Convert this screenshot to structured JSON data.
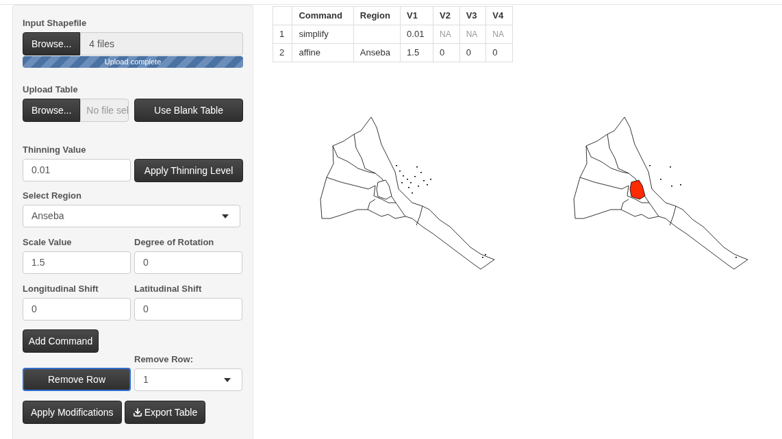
{
  "sidebar": {
    "shapefile": {
      "label": "Input Shapefile",
      "browse": "Browse...",
      "value": "4 files",
      "progress": {
        "level": 1,
        "text": "Upload complete"
      }
    },
    "upload_table": {
      "label": "Upload Table",
      "browse": "Browse...",
      "placeholder": "No file sel",
      "button": "Use Blank Table"
    },
    "thinning": {
      "label": "Thinning Value",
      "value": "0.01",
      "button": "Apply Thinning Level"
    },
    "region": {
      "label": "Select Region",
      "value": "Anseba"
    },
    "pairs": [
      [
        {
          "label": "Scale Value",
          "value": "1.5"
        },
        {
          "label": "Degree of Rotation",
          "value": "0"
        }
      ],
      [
        {
          "label": "Longitudinal Shift",
          "value": "0"
        },
        {
          "label": "Latitudinal Shift",
          "value": "0"
        }
      ]
    ],
    "add_button": "Add Command",
    "remove": {
      "label": "Remove Row:",
      "button": "Remove Row",
      "focused": true,
      "value": "1"
    },
    "apply_button": "Apply Modifications",
    "export_button": "Export Table"
  },
  "table": {
    "columns": [
      "",
      "Command",
      "Region",
      "V1",
      "V2",
      "V3",
      "V4"
    ],
    "rows": [
      [
        {
          "text": "1",
          "na": false
        },
        {
          "text": "simplify",
          "na": false
        },
        {
          "text": "",
          "na": false
        },
        {
          "text": "0.01",
          "na": false
        },
        {
          "text": "NA",
          "na": true
        },
        {
          "text": "NA",
          "na": true
        },
        {
          "text": "NA",
          "na": true
        }
      ],
      [
        {
          "text": "2",
          "na": false
        },
        {
          "text": "affine",
          "na": false
        },
        {
          "text": "Anseba",
          "na": false
        },
        {
          "text": "1.5",
          "na": false
        },
        {
          "text": "0",
          "na": false
        },
        {
          "text": "0",
          "na": false
        },
        {
          "text": "0",
          "na": false
        }
      ]
    ]
  },
  "maps": [
    {
      "highlighted": false
    },
    {
      "highlighted": true
    }
  ]
}
